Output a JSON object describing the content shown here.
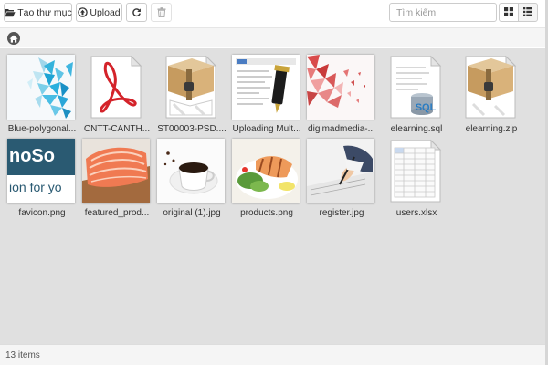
{
  "toolbar": {
    "new_folder_label": "Tạo thư mục",
    "upload_label": "Upload",
    "search_placeholder": "Tìm kiếm"
  },
  "icons": {
    "new_folder": "folder-open-icon",
    "upload": "upload-icon",
    "refresh": "refresh-icon",
    "delete": "trash-icon",
    "grid_view": "grid-view-icon",
    "list_view": "list-view-icon",
    "home": "home-icon"
  },
  "files": [
    {
      "name": "Blue-polygonal...",
      "thumb": "blue-polygon-image"
    },
    {
      "name": "CNTT-CANTH...",
      "thumb": "pdf-file-icon"
    },
    {
      "name": "ST00003-PSD....",
      "thumb": "zip-archive-icon"
    },
    {
      "name": "Uploading Mult...",
      "thumb": "document-file-icon"
    },
    {
      "name": "digimadmedia-...",
      "thumb": "red-polygon-image"
    },
    {
      "name": "elearning.sql",
      "thumb": "sql-file-icon"
    },
    {
      "name": "elearning.zip",
      "thumb": "zip-archive-icon"
    },
    {
      "name": "favicon.png",
      "thumb": "favicon-image"
    },
    {
      "name": "featured_prod...",
      "thumb": "salmon-image"
    },
    {
      "name": "original (1).jpg",
      "thumb": "coffee-image"
    },
    {
      "name": "products.png",
      "thumb": "grilled-fish-image"
    },
    {
      "name": "register.jpg",
      "thumb": "signing-hand-image"
    },
    {
      "name": "users.xlsx",
      "thumb": "spreadsheet-file-icon"
    }
  ],
  "favicon_text": {
    "line1": "noSo",
    "line2": "ion for yo"
  },
  "sql_label": "SQL",
  "status": {
    "item_count": "13 items"
  },
  "colors": {
    "file_area": "#e0e0e0",
    "favicon_top": "#2a5a72",
    "pdf_red": "#d4232a"
  }
}
